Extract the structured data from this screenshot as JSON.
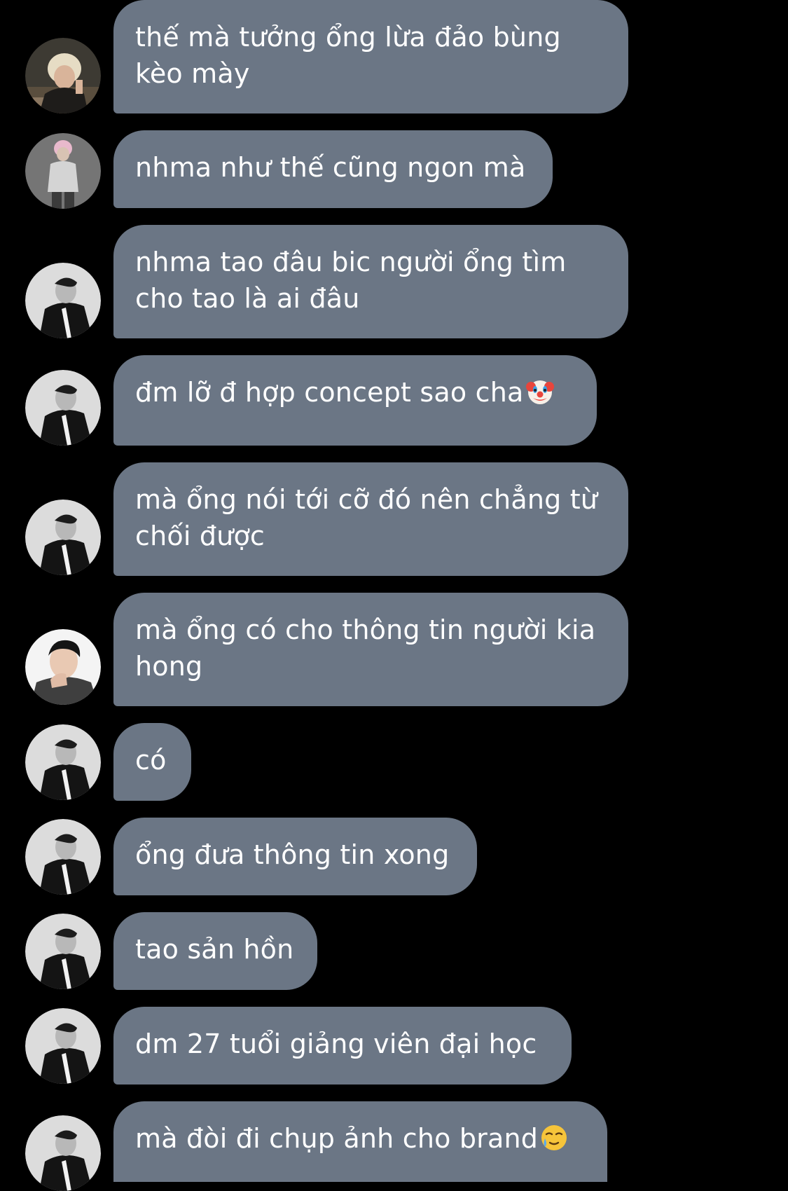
{
  "conversation": {
    "messages": [
      {
        "text": "thế mà tưởng ổng lừa đảo bùng kèo mày",
        "avatar": "avatar-friend-blonde",
        "emoji": ""
      },
      {
        "text": "nhma như thế cũng ngon mà",
        "avatar": "avatar-friend-pink-hair",
        "emoji": ""
      },
      {
        "text": "nhma tao đâu bic người ổng tìm cho tao là ai đâu",
        "avatar": "avatar-user-monochrome",
        "emoji": ""
      },
      {
        "text": "đm lỡ đ hợp concept sao cha",
        "avatar": "avatar-user-monochrome",
        "emoji": "clown-face-emoji"
      },
      {
        "text": "mà ổng nói tới cỡ đó nên chẳng từ chối được",
        "avatar": "avatar-user-monochrome",
        "emoji": ""
      },
      {
        "text": "mà ổng có cho thông tin người kia hong",
        "avatar": "avatar-friend-dark-hair",
        "emoji": ""
      },
      {
        "text": "có",
        "avatar": "avatar-user-monochrome",
        "emoji": ""
      },
      {
        "text": "ổng đưa thông tin xong",
        "avatar": "avatar-user-monochrome",
        "emoji": ""
      },
      {
        "text": "tao sản hồn",
        "avatar": "avatar-user-monochrome",
        "emoji": ""
      },
      {
        "text": "dm 27 tuổi giảng viên đại học",
        "avatar": "avatar-user-monochrome",
        "emoji": ""
      },
      {
        "text": "mà đòi đi chụp ảnh cho brand",
        "avatar": "avatar-user-monochrome",
        "emoji": "crying-smile-emoji"
      }
    ]
  },
  "colors": {
    "background": "#000000",
    "bubble": "#6b7685",
    "text": "#ffffff"
  }
}
